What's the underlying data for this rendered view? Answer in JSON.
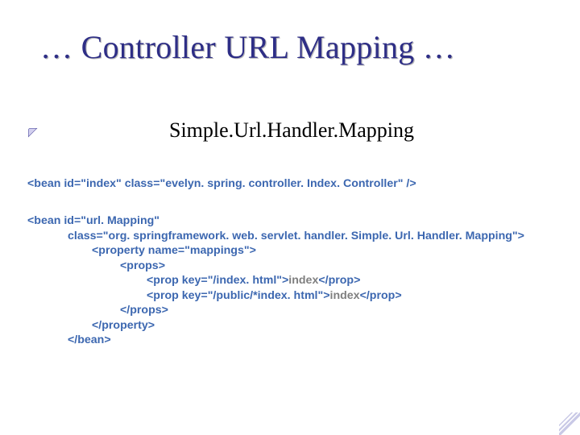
{
  "title": "… Controller URL Mapping …",
  "subtitle": "Simple.Url.Handler.Mapping",
  "code": {
    "bean1": {
      "open": "<bean ",
      "id_attr": "id=\"index\" ",
      "class_attr": "class=\"evelyn. spring. controller. Index. Controller\" ",
      "close": "/>"
    },
    "bean2": {
      "open": "<bean ",
      "id_attr": "id=\"url. Mapping\"",
      "class_attr_name": "class=",
      "class_attr_val": "\"org. springframework. web. servlet. handler. Simple. Url. Handler. Mapping\"",
      "open_end": ">",
      "property_open": "<property ",
      "property_attr": "name=\"mappings\"",
      "property_open_end": ">",
      "props_open": "<props>",
      "prop1_open": "<prop ",
      "prop1_attr": "key=\"/index. html\">",
      "prop1_text": "index",
      "prop1_close": "</prop>",
      "prop2_open": "<prop ",
      "prop2_attr": "key=\"/public/*index. html\">",
      "prop2_text": "index",
      "prop2_close": "</prop>",
      "props_close": "</props>",
      "property_close": "</property>",
      "bean_close": "</bean>"
    }
  }
}
